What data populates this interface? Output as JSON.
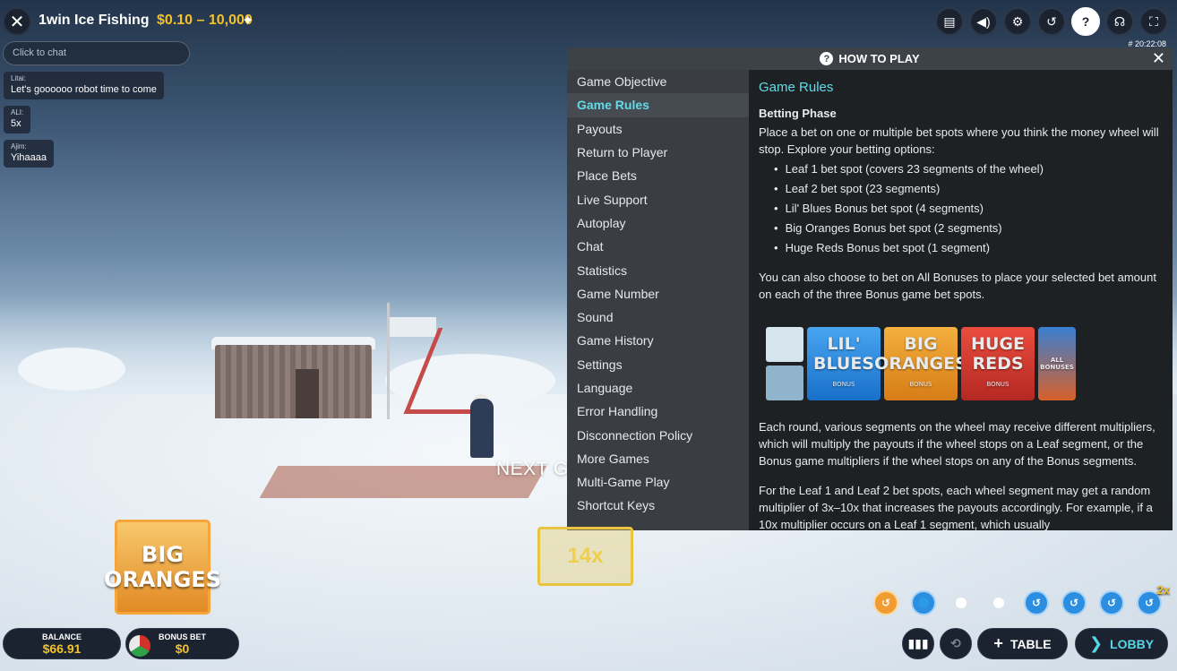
{
  "header": {
    "title": "1win Ice Fishing",
    "bet_range": "$0.10 – 10,000",
    "clock": "# 20:22:08"
  },
  "top_icons": [
    "chat-icon",
    "sound-icon",
    "settings-icon",
    "history-icon",
    "help-icon",
    "support-icon",
    "fullscreen-icon"
  ],
  "chat": {
    "placeholder": "Click to chat",
    "messages": [
      {
        "user": "Litai:",
        "text": "Let's goooooo robot time to come"
      },
      {
        "user": "ALI:",
        "text": "5x"
      },
      {
        "user": "Ajim:",
        "text": "Yihaaaa"
      }
    ]
  },
  "status_text": "NEXT GAME SOON",
  "how_to_play": {
    "title": "HOW TO PLAY",
    "nav": [
      "Game Objective",
      "Game Rules",
      "Payouts",
      "Return to Player",
      "Place Bets",
      "Live Support",
      "Autoplay",
      "Chat",
      "Statistics",
      "Game Number",
      "Sound",
      "Game History",
      "Settings",
      "Language",
      "Error Handling",
      "Disconnection Policy",
      "More Games",
      "Multi-Game Play",
      "Shortcut Keys"
    ],
    "active_nav": "Game Rules",
    "content": {
      "heading": "Game Rules",
      "subheading": "Betting Phase",
      "intro": "Place a bet on one or multiple bet spots where you think the money wheel will stop. Explore your betting options:",
      "bullets": [
        "Leaf 1 bet spot (covers 23 segments of the wheel)",
        "Leaf 2 bet spot (23 segments)",
        "Lil' Blues Bonus bet spot (4 segments)",
        "Big Oranges Bonus bet spot (2 segments)",
        "Huge Reds Bonus bet spot (1 segment)"
      ],
      "all_bonuses": "You can also choose to bet on All Bonuses to place your selected bet amount on each of the three Bonus game bet spots.",
      "tiles": {
        "blue": "LIL' BLUES",
        "orange": "BIG ORANGES",
        "red": "HUGE REDS",
        "bonus": "BONUS",
        "all": "ALL BONUSES"
      },
      "multipliers": "Each round, various segments on the wheel may receive different multipliers, which will multiply the payouts if the wheel stops on a Leaf segment, or the Bonus game multipliers if the wheel stops on any of the Bonus segments.",
      "leaf_random": "For the Leaf 1 and Leaf 2 bet spots, each wheel segment may get a random multiplier of 3x–10x that increases the payouts accordingly. For example, if a 10x multiplier occurs on a Leaf 1 segment, which usually"
    }
  },
  "promo_tile": [
    "BIG",
    "ORANGES"
  ],
  "multiplier_tile": "14x",
  "history_badge": "2x",
  "footer": {
    "balance_label": "BALANCE",
    "balance_value": "$66.91",
    "bonus_label": "BONUS BET",
    "bonus_value": "$0",
    "table_label": "TABLE",
    "lobby_label": "LOBBY"
  },
  "colors": {
    "accent_cyan": "#63dbe7",
    "gold": "#f3c22b",
    "panel_bg": "#2f3338"
  }
}
